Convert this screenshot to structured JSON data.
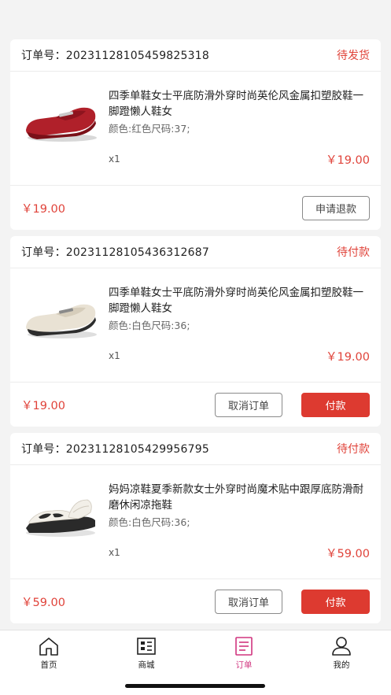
{
  "orders": [
    {
      "order_no": "订单号：20231128105459825318",
      "status": "待发货",
      "title": "四季单鞋女士平底防滑外穿时尚英伦风金属扣塑胶鞋一脚蹬懒人鞋女",
      "spec": "颜色:红色尺码:37;",
      "qty": "x1",
      "price": "￥19.00",
      "total": "￥19.00",
      "shoe_color": "#b0202a",
      "buttons": [
        {
          "label": "申请退款",
          "style": "outline"
        }
      ]
    },
    {
      "order_no": "订单号：20231128105436312687",
      "status": "待付款",
      "title": "四季单鞋女士平底防滑外穿时尚英伦风金属扣塑胶鞋一脚蹬懒人鞋女",
      "spec": "颜色:白色尺码:36;",
      "qty": "x1",
      "price": "￥19.00",
      "total": "￥19.00",
      "shoe_color": "#e9e2d4",
      "buttons": [
        {
          "label": "取消订单",
          "style": "outline"
        },
        {
          "label": "付款",
          "style": "solid"
        }
      ]
    },
    {
      "order_no": "订单号：20231128105429956795",
      "status": "待付款",
      "title": "妈妈凉鞋夏季新款女士外穿时尚魔术贴中跟厚底防滑耐磨休闲凉拖鞋",
      "spec": "颜色:白色尺码:36;",
      "qty": "x1",
      "price": "￥59.00",
      "total": "￥59.00",
      "shoe_color": "#f2efe8",
      "buttons": [
        {
          "label": "取消订单",
          "style": "outline"
        },
        {
          "label": "付款",
          "style": "solid"
        }
      ]
    }
  ],
  "tabbar": {
    "items": [
      {
        "label": "首页",
        "icon": "home-icon"
      },
      {
        "label": "商城",
        "icon": "store-icon"
      },
      {
        "label": "订单",
        "icon": "order-list-icon",
        "active": true
      },
      {
        "label": "我的",
        "icon": "profile-icon"
      }
    ]
  },
  "colors": {
    "accent_red": "#e0433a",
    "active_tab": "#d0357f"
  }
}
